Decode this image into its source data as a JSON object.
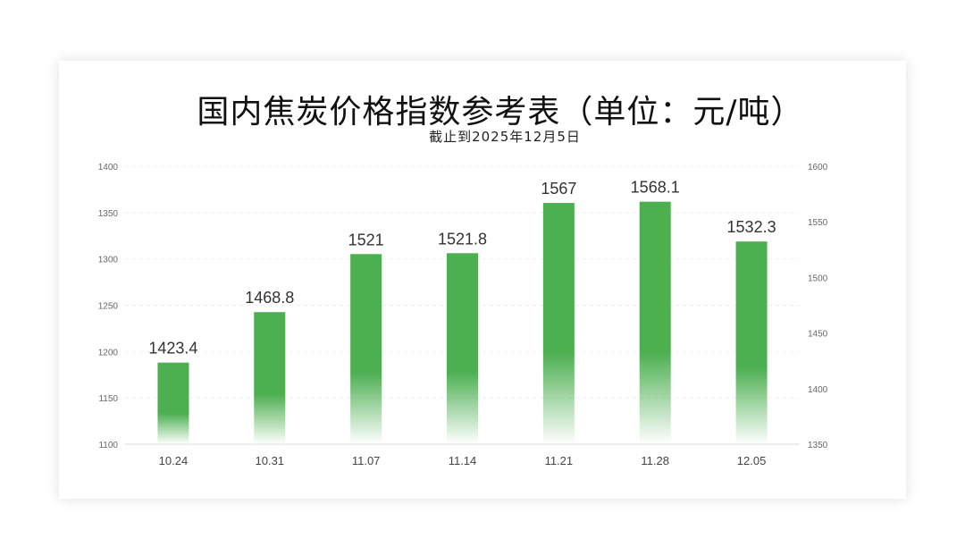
{
  "chart_data": {
    "type": "bar",
    "title": "国内焦炭价格指数参考表（单位：元/吨）",
    "subtitle": "截止到2025年12月5日",
    "categories": [
      "10.24",
      "10.31",
      "11.07",
      "11.14",
      "11.21",
      "11.28",
      "12.05"
    ],
    "series": [
      {
        "values": [
          1423.4,
          1468.8,
          1521,
          1521.8,
          1567,
          1568.1,
          1532.3
        ],
        "color": "#4caf50"
      }
    ],
    "value_labels": [
      "1423.4",
      "1468.8",
      "1521",
      "1521.8",
      "1567",
      "1568.1",
      "1532.3"
    ],
    "y_left": {
      "ylim": [
        1100,
        1400
      ],
      "ticks": [
        "1100",
        "1150",
        "1200",
        "1250",
        "1300",
        "1350",
        "1400"
      ]
    },
    "y_right": {
      "ylim": [
        1350,
        1600
      ],
      "ticks": [
        "1350",
        "1400",
        "1450",
        "1500",
        "1550",
        "1600"
      ]
    },
    "bars_plotted_on": "right",
    "grid": true,
    "legend": "none"
  }
}
